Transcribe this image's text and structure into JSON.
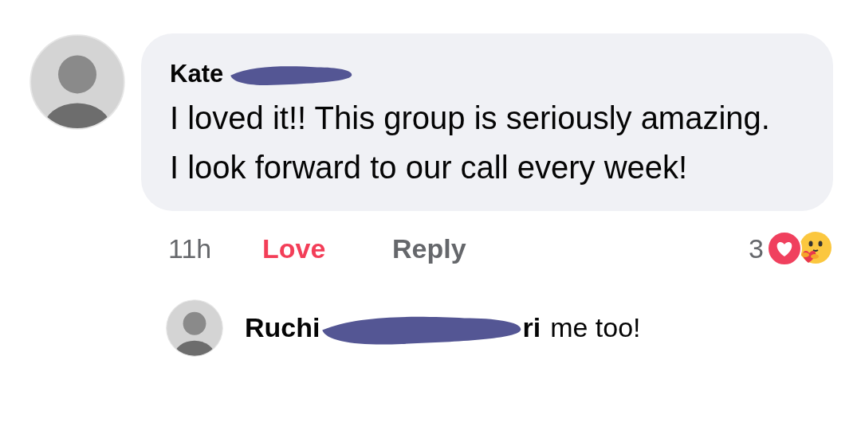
{
  "comment": {
    "author": "Kate",
    "text": "I loved it!! This group is seriously amazing. I look forward to our call every week!",
    "time": "11h",
    "reaction_button": {
      "label": "Love",
      "selected": true
    },
    "reply_button": "Reply",
    "reaction_count": "3"
  },
  "reply": {
    "author_start": "Ruchi",
    "author_end": "ri",
    "text": "me too!"
  }
}
